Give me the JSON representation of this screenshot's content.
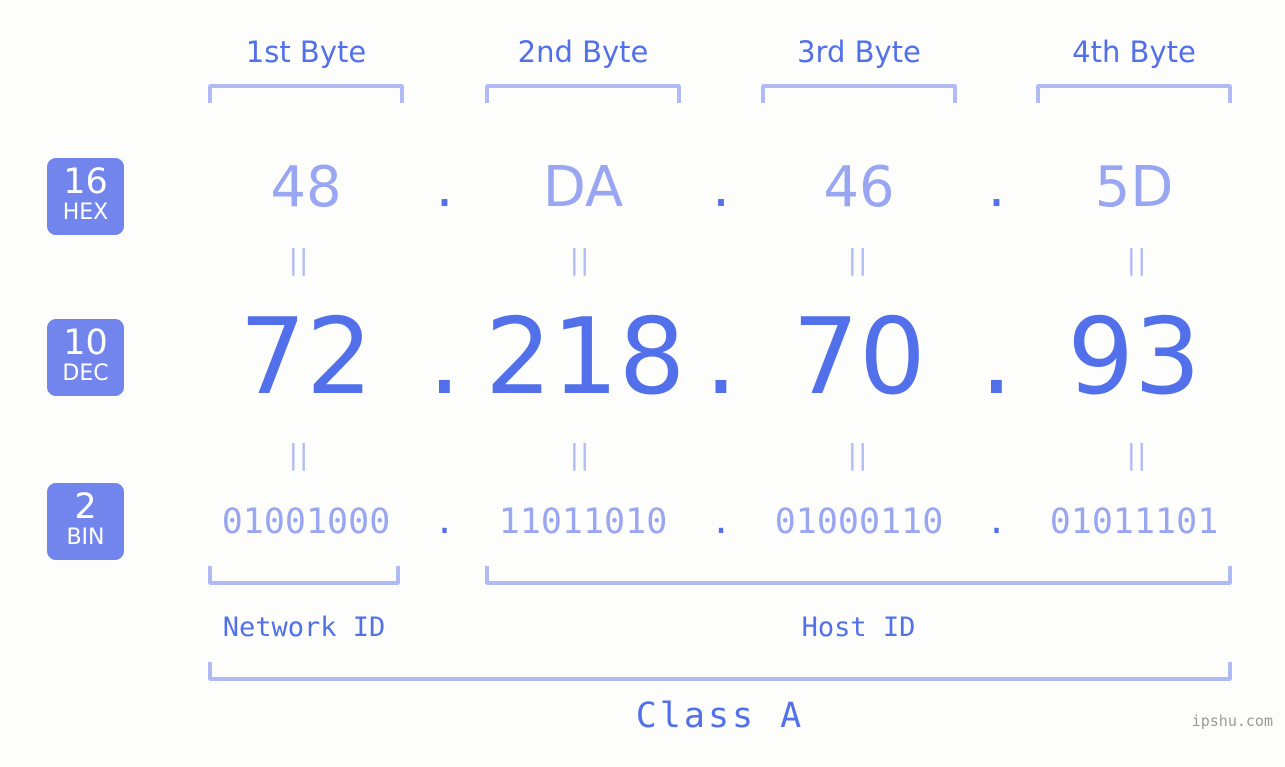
{
  "background_color": "#fdfefb",
  "colors": {
    "primary_blue": "#5270ea",
    "light_blue": "#99a7f2",
    "bracket_blue": "#b0bbf5",
    "badge_fill": "#7185ec",
    "badge_text": "#ffffff",
    "watermark": "#9a9a9a"
  },
  "byte_headers": [
    {
      "label": "1st Byte"
    },
    {
      "label": "2nd Byte"
    },
    {
      "label": "3rd Byte"
    },
    {
      "label": "4th Byte"
    }
  ],
  "radix_badges": [
    {
      "number": "16",
      "name": "HEX"
    },
    {
      "number": "10",
      "name": "DEC"
    },
    {
      "number": "2",
      "name": "BIN"
    }
  ],
  "rows": {
    "hex": {
      "radix": "16",
      "name": "HEX",
      "values": [
        "48",
        "DA",
        "46",
        "5D"
      ],
      "separator": "."
    },
    "dec": {
      "radix": "10",
      "name": "DEC",
      "values": [
        "72",
        "218",
        "70",
        "93"
      ],
      "separator": "."
    },
    "bin": {
      "radix": "2",
      "name": "BIN",
      "values": [
        "01001000",
        "11011010",
        "01000110",
        "01011101"
      ],
      "separator": "."
    }
  },
  "equals_marks": [
    {
      "symbol": "||"
    },
    {
      "symbol": "||"
    },
    {
      "symbol": "||"
    },
    {
      "symbol": "||"
    },
    {
      "symbol": "||"
    },
    {
      "symbol": "||"
    },
    {
      "symbol": "||"
    },
    {
      "symbol": "||"
    }
  ],
  "segments": {
    "network_id_label": "Network ID",
    "host_id_label": "Host ID",
    "class_label": "Class A"
  },
  "watermark": "ipshu.com"
}
